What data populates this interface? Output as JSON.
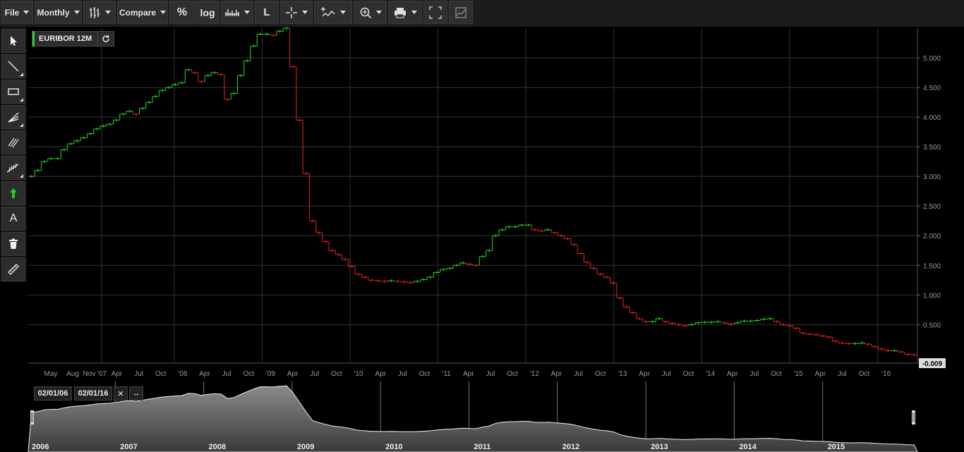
{
  "toolbar": {
    "file_label": "File",
    "period_label": "Monthly",
    "compare_label": "Compare",
    "percent_label": "%",
    "log_label": "log",
    "l_label": "L"
  },
  "left_tools": {
    "text_tool_label": "A"
  },
  "symbol": {
    "name": "EURIBOR 12M"
  },
  "navigator": {
    "start_date": "02/01/06",
    "end_date": "02/01/16",
    "close_label": "✕",
    "reset_label": "↔",
    "year_labels": [
      "2006",
      "2007",
      "2008",
      "2009",
      "2010",
      "2011",
      "2012",
      "2013",
      "2014",
      "2015"
    ]
  },
  "colors": {
    "up": "#22dd22",
    "down": "#ee2222",
    "grid": "#333333",
    "background": "#000000"
  },
  "chart_data": {
    "type": "line",
    "title": "EURIBOR 12M",
    "style": "step ohlc bars, green up / red down",
    "x_tick_labels": [
      "May",
      "Aug",
      "Nov '07",
      "Apr",
      "Jul",
      "Oct",
      "'08",
      "Apr",
      "Jul",
      "Oct",
      "'09",
      "Apr",
      "Jul",
      "Oct",
      "'10",
      "Apr",
      "Jul",
      "Oct",
      "'11",
      "Apr",
      "Jul",
      "Oct",
      "'12",
      "Apr",
      "Jul",
      "Oct",
      "'13",
      "Apr",
      "Jul",
      "Oct",
      "'14",
      "Apr",
      "Jul",
      "Oct",
      "'15",
      "Apr",
      "Jul",
      "Oct",
      "'16"
    ],
    "y_ticks": [
      "0.500",
      "1.000",
      "1.500",
      "2.000",
      "2.500",
      "3.000",
      "3.500",
      "4.000",
      "4.500",
      "5.000"
    ],
    "ylim": [
      -0.15,
      5.5
    ],
    "last_value_label": "-0.009",
    "grid": true,
    "series": [
      {
        "values": [
          3.0,
          3.1,
          3.25,
          3.3,
          3.3,
          3.45,
          3.55,
          3.6,
          3.65,
          3.72,
          3.8,
          3.85,
          3.88,
          3.95,
          4.05,
          4.1,
          4.05,
          4.15,
          4.25,
          4.35,
          4.45,
          4.5,
          4.55,
          4.58,
          4.8,
          4.75,
          4.6,
          4.7,
          4.75,
          4.72,
          4.3,
          4.4,
          4.7,
          4.95,
          5.2,
          5.4,
          5.4,
          5.38,
          5.45,
          5.5,
          4.85,
          3.95,
          3.05,
          2.25,
          2.05,
          1.9,
          1.75,
          1.68,
          1.6,
          1.48,
          1.35,
          1.3,
          1.25,
          1.24,
          1.23,
          1.24,
          1.23,
          1.22,
          1.21,
          1.23,
          1.26,
          1.3,
          1.38,
          1.43,
          1.45,
          1.5,
          1.54,
          1.52,
          1.5,
          1.65,
          1.75,
          2.0,
          2.1,
          2.15,
          2.15,
          2.18,
          2.18,
          2.1,
          2.08,
          2.1,
          2.05,
          2.0,
          1.95,
          1.85,
          1.7,
          1.55,
          1.45,
          1.35,
          1.3,
          1.2,
          0.95,
          0.8,
          0.7,
          0.6,
          0.55,
          0.55,
          0.6,
          0.55,
          0.52,
          0.5,
          0.48,
          0.5,
          0.53,
          0.54,
          0.54,
          0.55,
          0.53,
          0.51,
          0.53,
          0.56,
          0.56,
          0.57,
          0.59,
          0.6,
          0.55,
          0.5,
          0.48,
          0.44,
          0.36,
          0.34,
          0.33,
          0.31,
          0.29,
          0.22,
          0.19,
          0.18,
          0.18,
          0.19,
          0.17,
          0.13,
          0.09,
          0.06,
          0.06,
          0.04,
          0.0,
          -0.01
        ]
      }
    ]
  }
}
